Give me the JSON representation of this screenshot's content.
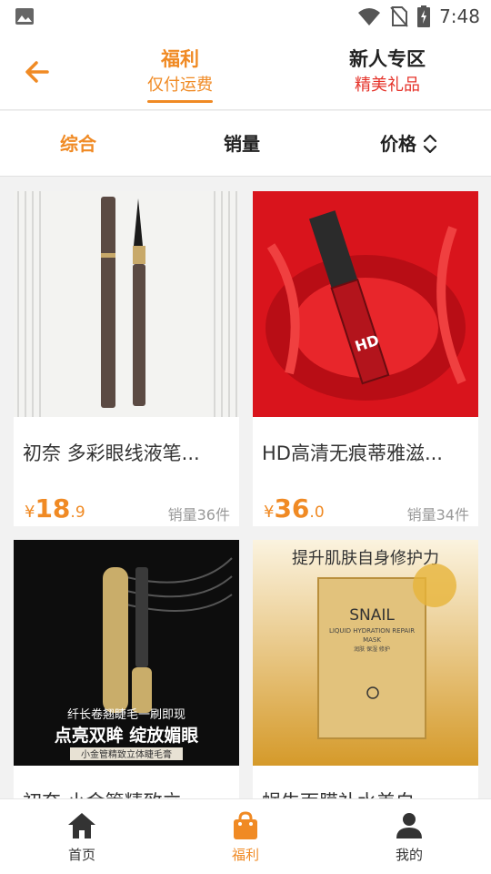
{
  "status_bar": {
    "time": "7:48",
    "icons": [
      "image-icon",
      "wifi-icon",
      "no-sim-icon",
      "battery-icon"
    ]
  },
  "header": {
    "back_icon": "back-arrow-icon",
    "tabs": [
      {
        "title": "福利",
        "subtitle": "仅付运费",
        "active": true
      },
      {
        "title": "新人专区",
        "subtitle": "精美礼品",
        "active": false
      }
    ]
  },
  "sort_bar": {
    "options": [
      "综合",
      "销量",
      "价格"
    ],
    "active": "综合",
    "price_icon": "sort-updown-icon"
  },
  "products": [
    {
      "title": "初奈 多彩眼线液笔...",
      "price_symbol": "¥",
      "price_int": "18",
      "price_dec": ".9",
      "sales": "销量36件"
    },
    {
      "title": "HD高清无痕蒂雅滋...",
      "price_symbol": "¥",
      "price_int": "36",
      "price_dec": ".0",
      "sales": "销量34件"
    },
    {
      "title": "初奈 小金管精致立...",
      "image_text": [
        "纤长卷翘睫毛一刷即现",
        "点亮双眸 绽放媚眼",
        "小金管精致立体睫毛膏"
      ]
    },
    {
      "title": "蜗牛面膜补水美白...",
      "image_text": [
        "提升肌肤自身修护力",
        "SNAIL",
        "LIQUID HYDRATION REPAIR",
        "MASK",
        "润肤 保湿 修护"
      ]
    }
  ],
  "bottom_nav": [
    {
      "label": "首页",
      "icon": "home-icon",
      "active": false
    },
    {
      "label": "福利",
      "icon": "shopping-bag-icon",
      "active": true
    },
    {
      "label": "我的",
      "icon": "person-icon",
      "active": false
    }
  ],
  "colors": {
    "accent": "#f08a24",
    "subtitle_red": "#e5332a",
    "text": "#333333",
    "muted": "#999999"
  }
}
